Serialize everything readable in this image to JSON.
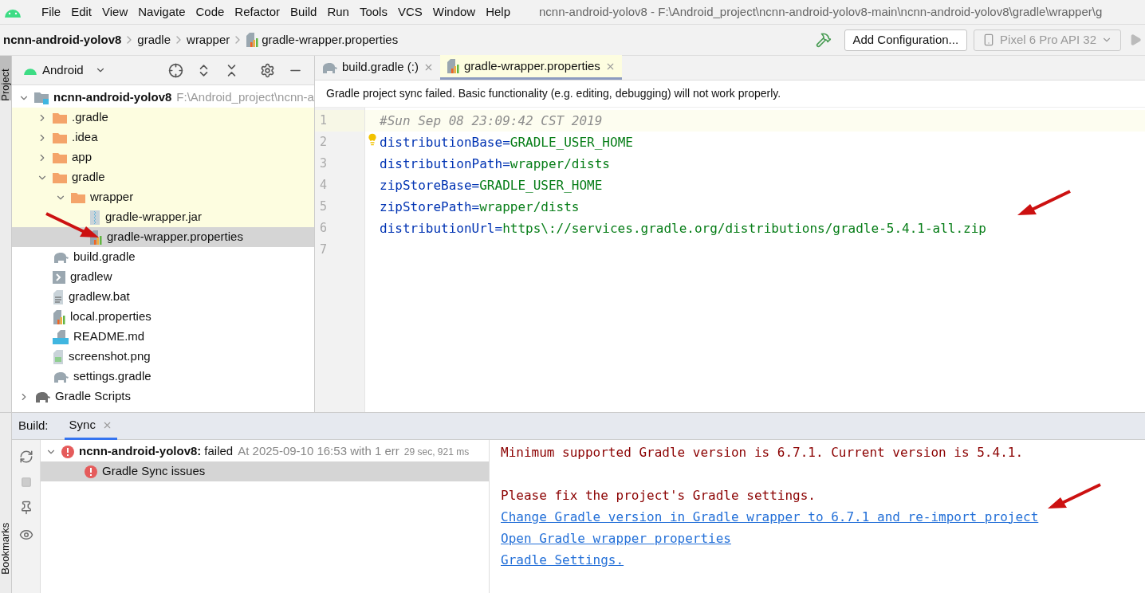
{
  "menu": [
    "File",
    "Edit",
    "View",
    "Navigate",
    "Code",
    "Refactor",
    "Build",
    "Run",
    "Tools",
    "VCS",
    "Window",
    "Help"
  ],
  "window_title": "ncnn-android-yolov8 - F:\\Android_project\\ncnn-android-yolov8-main\\ncnn-android-yolov8\\gradle\\wrapper\\g",
  "breadcrumbs": [
    {
      "label": "ncnn-android-yolov8",
      "kind": "project"
    },
    {
      "label": "gradle",
      "kind": "folder"
    },
    {
      "label": "wrapper",
      "kind": "folder"
    },
    {
      "label": "gradle-wrapper.properties",
      "kind": "properties"
    }
  ],
  "toolbar": {
    "config_button": "Add Configuration...",
    "device": "Pixel 6 Pro API 32"
  },
  "side_tabs": {
    "top": "Project",
    "bottom": "Bookmarks"
  },
  "project_panel": {
    "view": "Android",
    "tree": [
      {
        "label": "ncnn-android-yolov8",
        "path": "F:\\Android_project\\ncnn-a",
        "kind": "project",
        "expanded": true,
        "selected": false,
        "highlighted": false,
        "children": [
          {
            "label": ".gradle",
            "kind": "folder",
            "expanded": false,
            "selected": false,
            "highlighted": true
          },
          {
            "label": ".idea",
            "kind": "folder",
            "expanded": false,
            "selected": false,
            "highlighted": true
          },
          {
            "label": "app",
            "kind": "folder",
            "expanded": false,
            "selected": false,
            "highlighted": true
          },
          {
            "label": "gradle",
            "kind": "folder",
            "expanded": true,
            "selected": false,
            "highlighted": true,
            "children": [
              {
                "label": "wrapper",
                "kind": "folder",
                "expanded": true,
                "selected": false,
                "highlighted": true,
                "children": [
                  {
                    "label": "gradle-wrapper.jar",
                    "kind": "jar",
                    "selected": false,
                    "highlighted": true
                  },
                  {
                    "label": "gradle-wrapper.properties",
                    "kind": "properties",
                    "selected": true,
                    "highlighted": false
                  }
                ]
              }
            ]
          },
          {
            "label": "build.gradle",
            "kind": "gradle",
            "selected": false,
            "highlighted": false
          },
          {
            "label": "gradlew",
            "kind": "exec",
            "selected": false,
            "highlighted": false
          },
          {
            "label": "gradlew.bat",
            "kind": "text",
            "selected": false,
            "highlighted": false
          },
          {
            "label": "local.properties",
            "kind": "properties",
            "selected": false,
            "highlighted": false
          },
          {
            "label": "README.md",
            "kind": "md",
            "selected": false,
            "highlighted": false
          },
          {
            "label": "screenshot.png",
            "kind": "image",
            "selected": false,
            "highlighted": false
          },
          {
            "label": "settings.gradle",
            "kind": "gradle",
            "selected": false,
            "highlighted": false
          }
        ]
      },
      {
        "label": "Gradle Scripts",
        "kind": "scripts",
        "expanded": false,
        "selected": false,
        "highlighted": false
      }
    ]
  },
  "editor": {
    "tabs": [
      {
        "label": "build.gradle (:)",
        "kind": "gradle",
        "selected": false
      },
      {
        "label": "gradle-wrapper.properties",
        "kind": "properties",
        "selected": true
      }
    ],
    "banner": "Gradle project sync failed. Basic functionality (e.g. editing, debugging) will not work properly.",
    "lines": [
      {
        "number": "1",
        "kind": "comment",
        "text": "#Sun Sep 08 23:09:42 CST 2019",
        "current": true
      },
      {
        "number": "2",
        "kind": "property",
        "key": "distributionBase=",
        "value": "GRADLE_USER_HOME",
        "current": false
      },
      {
        "number": "3",
        "kind": "property",
        "key": "distributionPath=",
        "value": "wrapper/dists",
        "current": false
      },
      {
        "number": "4",
        "kind": "property",
        "key": "zipStoreBase=",
        "value": "GRADLE_USER_HOME",
        "current": false
      },
      {
        "number": "5",
        "kind": "property",
        "key": "zipStorePath=",
        "value": "wrapper/dists",
        "current": false
      },
      {
        "number": "6",
        "kind": "property",
        "key": "distributionUrl=",
        "value": "https\\://services.gradle.org/distributions/gradle-5.4.1-all.zip",
        "current": false
      },
      {
        "number": "7",
        "kind": "empty",
        "current": false
      }
    ]
  },
  "build_panel": {
    "label": "Build:",
    "tabs": [
      {
        "label": "Sync",
        "selected": true
      }
    ],
    "tree": [
      {
        "name": "ncnn-android-yolov8:",
        "status": "failed",
        "detail": "At 2025-09-10 16:53 with 1 err",
        "duration": "29 sec, 921 ms",
        "selected": false,
        "children": [
          {
            "name": "Gradle Sync issues",
            "selected": true
          }
        ]
      }
    ],
    "console": [
      {
        "lines": [
          {
            "kind": "error",
            "text": "Minimum supported Gradle version is 6.7.1. Current version is 5.4.1."
          }
        ]
      },
      {
        "lines": [
          {
            "kind": "error",
            "text": "Please fix the project's Gradle settings."
          },
          {
            "kind": "link",
            "text": "Change Gradle version in Gradle wrapper to 6.7.1 and re-import project"
          },
          {
            "kind": "link",
            "text": "Open Gradle wrapper properties"
          },
          {
            "kind": "link",
            "text": "Gradle Settings."
          }
        ]
      }
    ]
  }
}
